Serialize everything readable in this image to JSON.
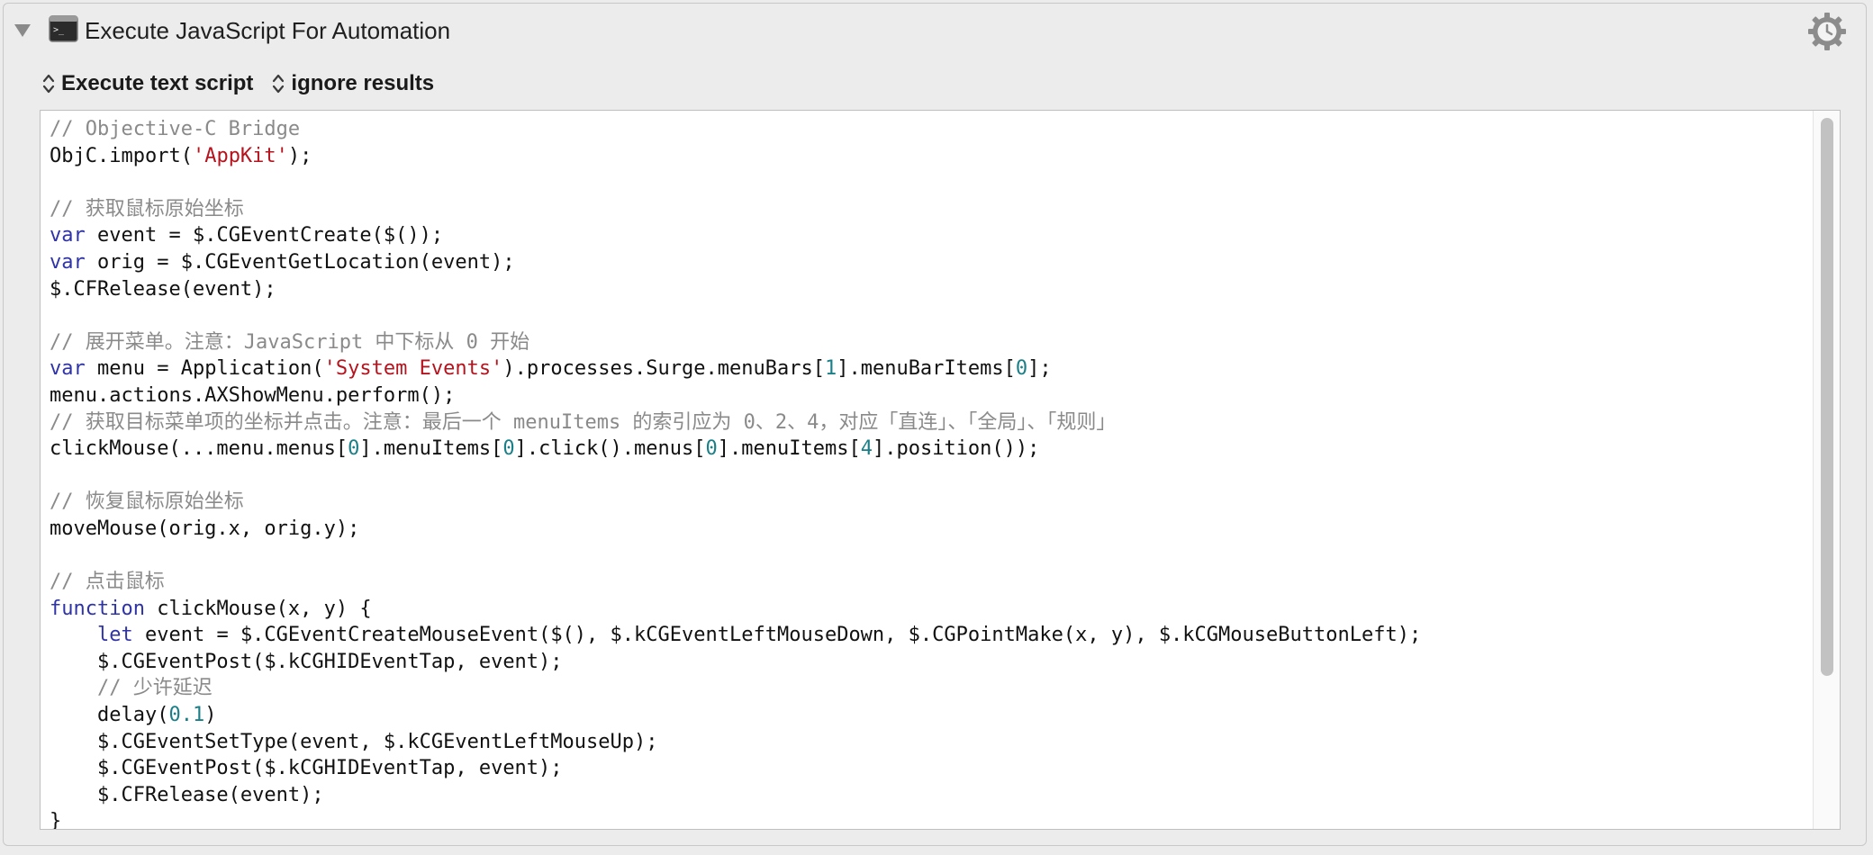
{
  "header": {
    "title": "Execute JavaScript For Automation",
    "app_icon": "terminal-icon",
    "gear_icon": "gear-clock-icon",
    "disclosure_icon": "triangle-down-icon"
  },
  "options": {
    "execute_mode": "Execute text script",
    "result_mode": "ignore results"
  },
  "colors": {
    "comment": "#8a8a8a",
    "keyword": "#2f33a8",
    "string": "#b5141e",
    "number": "#1b7f88"
  },
  "code_lines": [
    [
      {
        "t": "// Objective-C Bridge",
        "c": "cm"
      }
    ],
    [
      {
        "t": "ObjC.import("
      },
      {
        "t": "'AppKit'",
        "c": "str"
      },
      {
        "t": ");"
      }
    ],
    [],
    [
      {
        "t": "// 获取鼠标原始坐标",
        "c": "cm"
      }
    ],
    [
      {
        "t": "var",
        "c": "kw"
      },
      {
        "t": " event = $.CGEventCreate($());"
      }
    ],
    [
      {
        "t": "var",
        "c": "kw"
      },
      {
        "t": " orig = $.CGEventGetLocation(event);"
      }
    ],
    [
      {
        "t": "$.CFRelease(event);"
      }
    ],
    [],
    [
      {
        "t": "// 展开菜单。注意：JavaScript 中下标从 0 开始",
        "c": "cm"
      }
    ],
    [
      {
        "t": "var",
        "c": "kw"
      },
      {
        "t": " menu = Application("
      },
      {
        "t": "'System Events'",
        "c": "str"
      },
      {
        "t": ").processes.Surge.menuBars["
      },
      {
        "t": "1",
        "c": "num"
      },
      {
        "t": "].menuBarItems["
      },
      {
        "t": "0",
        "c": "num"
      },
      {
        "t": "];"
      }
    ],
    [
      {
        "t": "menu.actions.AXShowMenu.perform();"
      }
    ],
    [
      {
        "t": "// 获取目标菜单项的坐标并点击。注意：最后一个 menuItems 的索引应为 0、2、4，对应「直连」、「全局」、「规则」",
        "c": "cm"
      }
    ],
    [
      {
        "t": "clickMouse(...menu.menus["
      },
      {
        "t": "0",
        "c": "num"
      },
      {
        "t": "].menuItems["
      },
      {
        "t": "0",
        "c": "num"
      },
      {
        "t": "].click().menus["
      },
      {
        "t": "0",
        "c": "num"
      },
      {
        "t": "].menuItems["
      },
      {
        "t": "4",
        "c": "num"
      },
      {
        "t": "].position());"
      }
    ],
    [],
    [
      {
        "t": "// 恢复鼠标原始坐标",
        "c": "cm"
      }
    ],
    [
      {
        "t": "moveMouse(orig.x, orig.y);"
      }
    ],
    [],
    [
      {
        "t": "// 点击鼠标",
        "c": "cm"
      }
    ],
    [
      {
        "t": "function",
        "c": "kw"
      },
      {
        "t": " clickMouse(x, y) {"
      }
    ],
    [
      {
        "t": "    "
      },
      {
        "t": "let",
        "c": "kw"
      },
      {
        "t": " event = $.CGEventCreateMouseEvent($(), $.kCGEventLeftMouseDown, $.CGPointMake(x, y), $.kCGMouseButtonLeft);"
      }
    ],
    [
      {
        "t": "    $.CGEventPost($.kCGHIDEventTap, event);"
      }
    ],
    [
      {
        "t": "    "
      },
      {
        "t": "// 少许延迟",
        "c": "cm"
      }
    ],
    [
      {
        "t": "    delay("
      },
      {
        "t": "0.1",
        "c": "num"
      },
      {
        "t": ")"
      }
    ],
    [
      {
        "t": "    $.CGEventSetType(event, $.kCGEventLeftMouseUp);"
      }
    ],
    [
      {
        "t": "    $.CGEventPost($.kCGHIDEventTap, event);"
      }
    ],
    [
      {
        "t": "    $.CFRelease(event);"
      }
    ],
    [
      {
        "t": "}"
      }
    ]
  ]
}
